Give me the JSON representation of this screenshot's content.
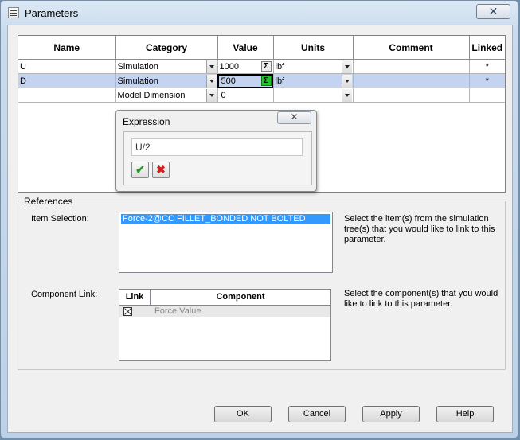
{
  "window": {
    "title": "Parameters",
    "close_glyph": "✕"
  },
  "grid": {
    "columns": [
      "Name",
      "Category",
      "Value",
      "Units",
      "Comment",
      "Linked"
    ],
    "rows": [
      {
        "name": "U",
        "category": "Simulation",
        "value": "1000",
        "units": "lbf",
        "comment": "",
        "linked": "*",
        "selected": false
      },
      {
        "name": "D",
        "category": "Simulation",
        "value": "500",
        "units": "lbf",
        "comment": "",
        "linked": "*",
        "selected": true
      },
      {
        "name": "",
        "category": "Model Dimension",
        "value": "0",
        "units": "",
        "comment": "",
        "linked": "",
        "selected": false
      }
    ],
    "sigma_glyph": "Σ"
  },
  "expression": {
    "title": "Expression",
    "close_glyph": "✕",
    "value": "U/2",
    "ok_glyph": "✔",
    "cancel_glyph": "✖"
  },
  "references": {
    "legend": "References",
    "item_selection_label": "Item Selection:",
    "item_selection_selected": "Force-2@CC FILLET_BONDED NOT BOLTED",
    "item_selection_help": "Select the item(s) from the simulation tree(s) that you would like to link to this parameter.",
    "component_link_label": "Component Link:",
    "component_table": {
      "headers": [
        "Link",
        "Component"
      ],
      "rows": [
        {
          "component": "Force Value"
        }
      ]
    },
    "component_link_help": "Select the component(s) that you would like to link to this parameter."
  },
  "buttons": {
    "ok": "OK",
    "cancel": "Cancel",
    "apply": "Apply",
    "help": "Help"
  },
  "colors": {
    "selected_row": "#c3d3f0",
    "list_selection": "#3399ff",
    "sigma_active": "#22c22a"
  }
}
